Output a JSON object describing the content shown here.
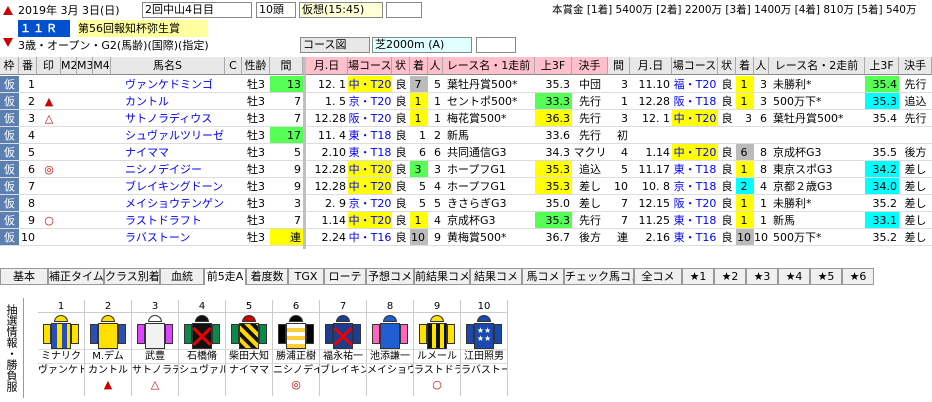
{
  "header": {
    "date": "2019年  3月  3日(日)",
    "meet": "2回中山4日目",
    "field_size": "10頭",
    "status": "仮想(15:45)",
    "prize": "本賞金 [1着] 5400万 [2着] 2200万 [3着] 1400万 [4着] 810万 [5着] 540万",
    "race_no": "１１Ｒ",
    "race_name": "第56回報知杯弥生賞",
    "conditions": "3歳・オープン・G2(馬齢)(国際)(指定)",
    "course_label": "コース図",
    "course": "芝2000m  (A)"
  },
  "columns": [
    "枠",
    "番",
    "印",
    "M2",
    "M3",
    "M4",
    "馬名S",
    "C",
    "性齢",
    "間",
    "月.日",
    "場コース",
    "状",
    "着",
    "人",
    "レース名・1走前",
    "上3F",
    "決手",
    "間",
    "月.日",
    "場コース",
    "状",
    "着",
    "人",
    "レース名・2走前",
    "上3F",
    "決手"
  ],
  "horses": [
    {
      "waku": "仮",
      "no": "1",
      "mark": "",
      "name": "ヴァンケドミンゴ",
      "sex": "牡3",
      "int": "13",
      "int_bg": "grn",
      "r1_date": "12. 1",
      "r1_course": "中・T20",
      "r1_cbg": "yel",
      "r1_cond": "良",
      "r1_pos": "7",
      "r1_pbg": "gray",
      "r1_pop": "5",
      "r1_race": "葉牡丹賞500*",
      "r1_3f": "35.3",
      "r1_3fbg": "",
      "r1_style": "中団",
      "int2": "3",
      "r2_date": "11.10",
      "r2_course": "福・T20",
      "r2_cbg": "",
      "r2_cond": "良",
      "r2_pos": "1",
      "r2_pbg": "yel",
      "r2_pop": "3",
      "r2_race": "未勝利*",
      "r2_3f": "35.4",
      "r2_3fbg": "grn",
      "r2_style": "先行"
    },
    {
      "waku": "仮",
      "no": "2",
      "mark": "▲",
      "name": "カントル",
      "sex": "牡3",
      "int": "7",
      "int_bg": "",
      "r1_date": "1. 5",
      "r1_course": "京・T20",
      "r1_cbg": "",
      "r1_cond": "良",
      "r1_pos": "1",
      "r1_pbg": "yel",
      "r1_pop": "1",
      "r1_race": "セントポ500*",
      "r1_3f": "33.3",
      "r1_3fbg": "grn",
      "r1_style": "先行",
      "int2": "1",
      "r2_date": "12.28",
      "r2_course": "阪・T18",
      "r2_cbg": "",
      "r2_cond": "良",
      "r2_pos": "1",
      "r2_pbg": "yel",
      "r2_pop": "3",
      "r2_race": "500万下*",
      "r2_3f": "35.3",
      "r2_3fbg": "cyan",
      "r2_style": "追込"
    },
    {
      "waku": "仮",
      "no": "3",
      "mark": "△",
      "name": "サトノラディウス",
      "sex": "牡3",
      "int": "7",
      "int_bg": "",
      "r1_date": "12.28",
      "r1_course": "阪・T20",
      "r1_cbg": "",
      "r1_cond": "良",
      "r1_pos": "1",
      "r1_pbg": "yel",
      "r1_pop": "1",
      "r1_race": "梅花賞500*",
      "r1_3f": "36.3",
      "r1_3fbg": "yel",
      "r1_style": "先行",
      "int2": "3",
      "r2_date": "12. 1",
      "r2_course": "中・T20",
      "r2_cbg": "yel",
      "r2_cond": "良",
      "r2_pos": "3",
      "r2_pbg": "",
      "r2_pop": "6",
      "r2_race": "葉牡丹賞500*",
      "r2_3f": "35.4",
      "r2_3fbg": "",
      "r2_style": "先行"
    },
    {
      "waku": "仮",
      "no": "4",
      "mark": "",
      "name": "シュヴァルツリーゼ",
      "sex": "牡3",
      "int": "17",
      "int_bg": "grn",
      "r1_date": "11. 4",
      "r1_course": "東・T18",
      "r1_cbg": "",
      "r1_cond": "良",
      "r1_pos": "1",
      "r1_pbg": "",
      "r1_pop": "2",
      "r1_race": "新馬",
      "r1_3f": "33.6",
      "r1_3fbg": "",
      "r1_style": "先行",
      "int2": "初",
      "r2_date": "",
      "r2_course": "",
      "r2_cbg": "",
      "r2_cond": "",
      "r2_pos": "",
      "r2_pbg": "",
      "r2_pop": "",
      "r2_race": "",
      "r2_3f": "",
      "r2_3fbg": "",
      "r2_style": ""
    },
    {
      "waku": "仮",
      "no": "5",
      "mark": "",
      "name": "ナイママ",
      "sex": "牡3",
      "int": "5",
      "int_bg": "",
      "r1_date": "2.10",
      "r1_course": "東・T18",
      "r1_cbg": "",
      "r1_cond": "良",
      "r1_pos": "6",
      "r1_pbg": "",
      "r1_pop": "6",
      "r1_race": "共同通信G3",
      "r1_3f": "34.3",
      "r1_3fbg": "",
      "r1_style": "マクリ",
      "int2": "4",
      "r2_date": "1.14",
      "r2_course": "中・T20",
      "r2_cbg": "yel",
      "r2_cond": "良",
      "r2_pos": "6",
      "r2_pbg": "gray",
      "r2_pop": "8",
      "r2_race": "京成杯G3",
      "r2_3f": "35.5",
      "r2_3fbg": "",
      "r2_style": "後方"
    },
    {
      "waku": "仮",
      "no": "6",
      "mark": "◎",
      "name": "ニシノデイジー",
      "sex": "牡3",
      "int": "9",
      "int_bg": "",
      "r1_date": "12.28",
      "r1_course": "中・T20",
      "r1_cbg": "yel",
      "r1_cond": "良",
      "r1_pos": "3",
      "r1_pbg": "grn",
      "r1_pop": "3",
      "r1_race": "ホープフG1",
      "r1_3f": "35.3",
      "r1_3fbg": "yel",
      "r1_style": "追込",
      "int2": "5",
      "r2_date": "11.17",
      "r2_course": "東・T18",
      "r2_cbg": "",
      "r2_cond": "良",
      "r2_pos": "1",
      "r2_pbg": "yel",
      "r2_pop": "8",
      "r2_race": "東京スポG3",
      "r2_3f": "34.2",
      "r2_3fbg": "cyan",
      "r2_style": "差し"
    },
    {
      "waku": "仮",
      "no": "7",
      "mark": "",
      "name": "ブレイキングドーン",
      "sex": "牡3",
      "int": "9",
      "int_bg": "",
      "r1_date": "12.28",
      "r1_course": "中・T20",
      "r1_cbg": "yel",
      "r1_cond": "良",
      "r1_pos": "5",
      "r1_pbg": "",
      "r1_pop": "4",
      "r1_race": "ホープフG1",
      "r1_3f": "35.3",
      "r1_3fbg": "yel",
      "r1_style": "差し",
      "int2": "10",
      "r2_date": "10. 8",
      "r2_course": "京・T18",
      "r2_cbg": "",
      "r2_cond": "良",
      "r2_pos": "2",
      "r2_pbg": "cyan",
      "r2_pop": "4",
      "r2_race": "京都２歳G3",
      "r2_3f": "34.0",
      "r2_3fbg": "cyan",
      "r2_style": "差し"
    },
    {
      "waku": "仮",
      "no": "8",
      "mark": "",
      "name": "メイショウテンゲン",
      "sex": "牡3",
      "int": "3",
      "int_bg": "",
      "r1_date": "2. 9",
      "r1_course": "京・T20",
      "r1_cbg": "",
      "r1_cond": "良",
      "r1_pos": "5",
      "r1_pbg": "",
      "r1_pop": "5",
      "r1_race": "きさらぎG3",
      "r1_3f": "35.0",
      "r1_3fbg": "",
      "r1_style": "差し",
      "int2": "7",
      "r2_date": "12.15",
      "r2_course": "阪・T20",
      "r2_cbg": "",
      "r2_cond": "良",
      "r2_pos": "1",
      "r2_pbg": "yel",
      "r2_pop": "1",
      "r2_race": "未勝利*",
      "r2_3f": "35.2",
      "r2_3fbg": "",
      "r2_style": "差し"
    },
    {
      "waku": "仮",
      "no": "9",
      "mark": "○",
      "name": "ラストドラフト",
      "sex": "牡3",
      "int": "7",
      "int_bg": "",
      "r1_date": "1.14",
      "r1_course": "中・T20",
      "r1_cbg": "yel",
      "r1_cond": "良",
      "r1_pos": "1",
      "r1_pbg": "yel",
      "r1_pop": "4",
      "r1_race": "京成杯G3",
      "r1_3f": "35.3",
      "r1_3fbg": "grn",
      "r1_style": "先行",
      "int2": "7",
      "r2_date": "11.25",
      "r2_course": "東・T18",
      "r2_cbg": "",
      "r2_cond": "良",
      "r2_pos": "1",
      "r2_pbg": "yel",
      "r2_pop": "1",
      "r2_race": "新馬",
      "r2_3f": "33.1",
      "r2_3fbg": "cyan",
      "r2_style": "差し"
    },
    {
      "waku": "仮",
      "no": "10",
      "mark": "",
      "name": "ラバストーン",
      "sex": "牡3",
      "int": "連",
      "int_bg": "yel",
      "r1_date": "2.24",
      "r1_course": "中・T16",
      "r1_cbg": "",
      "r1_cond": "良",
      "r1_pos": "10",
      "r1_pbg": "gray",
      "r1_pop": "9",
      "r1_race": "黄梅賞500*",
      "r1_3f": "36.7",
      "r1_3fbg": "",
      "r1_style": "後方",
      "int2": "連",
      "r2_date": "2.16",
      "r2_course": "東・T16",
      "r2_cbg": "",
      "r2_cond": "良",
      "r2_pos": "10",
      "r2_pbg": "gray",
      "r2_pop": "10",
      "r2_race": "500万下*",
      "r2_3f": "35.2",
      "r2_3fbg": "",
      "r2_style": "差し"
    }
  ],
  "tabs": [
    "基本",
    "補正タイム",
    "クラス別着",
    "血統",
    "前5走A",
    "着度数",
    "TGX",
    "ローテ",
    "予想コメ",
    "前結果コメ",
    "結果コメ",
    "馬コメ",
    "チェック馬コメ",
    "全コメ",
    "★1",
    "★2",
    "★3",
    "★4",
    "★5",
    "★6"
  ],
  "active_tab": "前5走A",
  "side_label": "抽選情報・勝負服",
  "jockeys": [
    {
      "no": "1",
      "name": "ミナリク",
      "horse": "ヴァンケド",
      "mark": ""
    },
    {
      "no": "2",
      "name": "M.デム",
      "horse": "カントル",
      "mark": "▲"
    },
    {
      "no": "3",
      "name": "武豊",
      "horse": "サトノラデ",
      "mark": "△"
    },
    {
      "no": "4",
      "name": "石橋脩",
      "horse": "シュヴァル",
      "mark": ""
    },
    {
      "no": "5",
      "name": "柴田大知",
      "horse": "ナイママ",
      "mark": ""
    },
    {
      "no": "6",
      "name": "勝浦正樹",
      "horse": "ニシノデイ",
      "mark": "◎"
    },
    {
      "no": "7",
      "name": "福永祐一",
      "horse": "ブレイキン",
      "mark": ""
    },
    {
      "no": "8",
      "name": "池添謙一",
      "horse": "メイショウ",
      "mark": ""
    },
    {
      "no": "9",
      "name": "ルメール",
      "horse": "ラストドラ",
      "mark": "○"
    },
    {
      "no": "10",
      "name": "江田照男",
      "horse": "ラバストー",
      "mark": ""
    }
  ]
}
